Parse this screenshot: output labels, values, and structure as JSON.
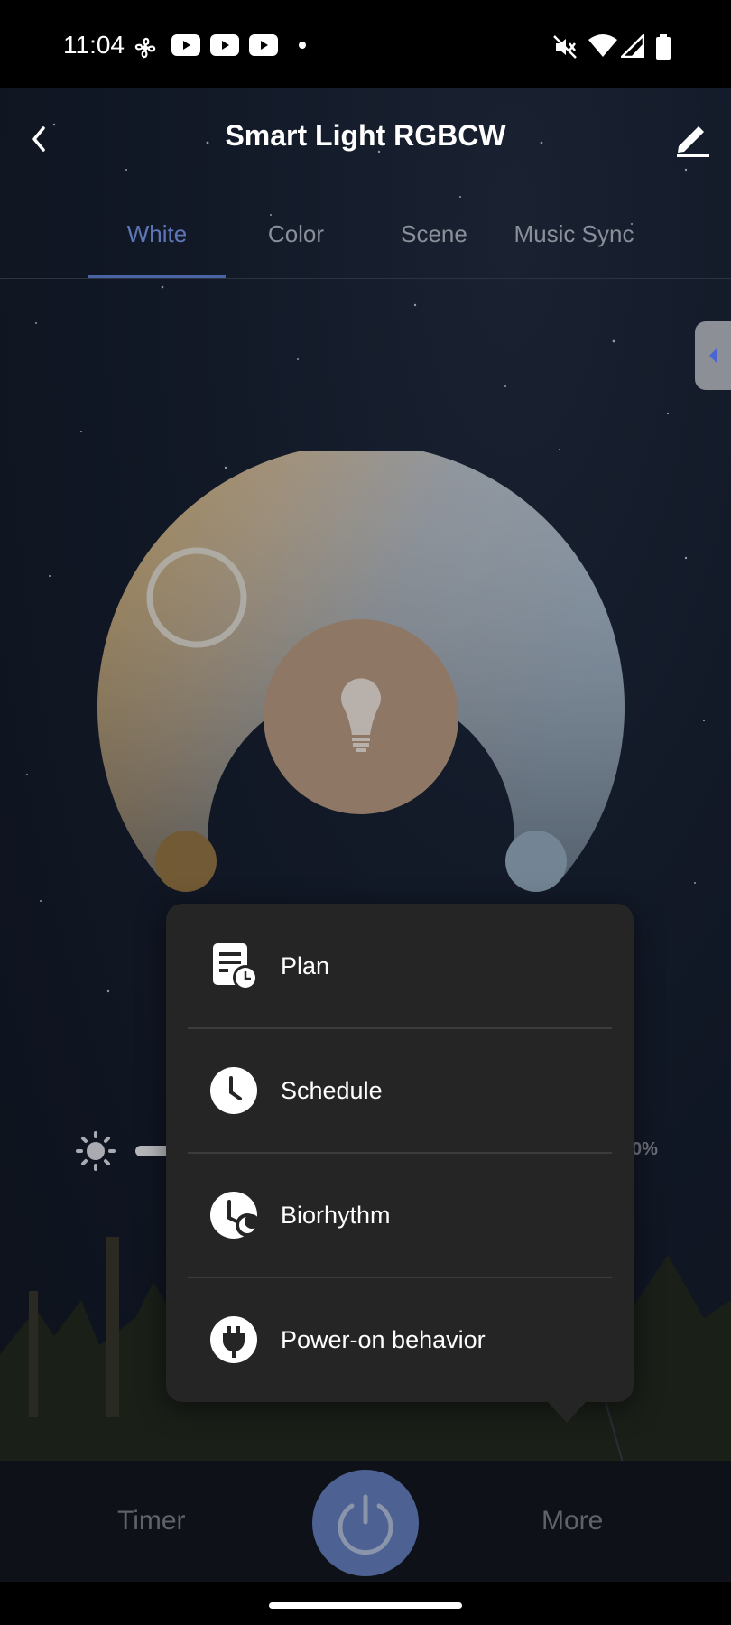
{
  "status_bar": {
    "time": "11:04",
    "icons_left": [
      "fan-icon",
      "youtube-icon",
      "youtube-icon",
      "youtube-icon",
      "dot-icon"
    ],
    "icons_right": [
      "mute-icon",
      "wifi-icon",
      "signal-icon",
      "battery-icon"
    ]
  },
  "header": {
    "title": "Smart Light RGBCW",
    "back_icon": "chevron-left-icon",
    "edit_icon": "pencil-icon"
  },
  "tabs": [
    {
      "label": "White",
      "active": true
    },
    {
      "label": "Color",
      "active": false
    },
    {
      "label": "Scene",
      "active": false
    },
    {
      "label": "Music Sync",
      "active": false
    }
  ],
  "colors": {
    "accent": "#4a64a6",
    "warm": "#c69a4a",
    "cool": "#a9b8c6",
    "center": "#8f7766",
    "menu_bg": "#252525",
    "power_btn": "#4d6192"
  },
  "brightness": {
    "icon": "sun-icon",
    "value_text": "0%"
  },
  "popup_menu": {
    "items": [
      {
        "label": "Plan",
        "icon": "plan-icon"
      },
      {
        "label": "Schedule",
        "icon": "clock-icon"
      },
      {
        "label": "Biorhythm",
        "icon": "biorhythm-icon"
      },
      {
        "label": "Power-on behavior",
        "icon": "plug-icon"
      }
    ]
  },
  "bottom_bar": {
    "timer_label": "Timer",
    "more_label": "More",
    "power_icon": "power-icon"
  }
}
